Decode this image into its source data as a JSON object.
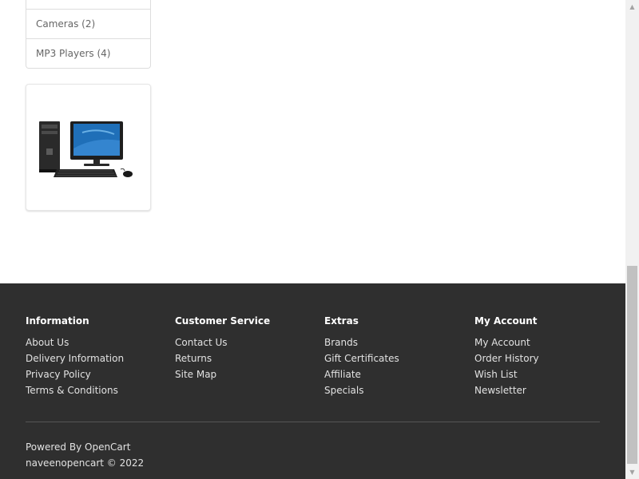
{
  "categories": {
    "items": [
      {
        "label": ""
      },
      {
        "label": "Cameras (2)"
      },
      {
        "label": "MP3 Players (4)"
      }
    ]
  },
  "banner": {
    "icon": "desktop-computer-image"
  },
  "footer": {
    "columns": [
      {
        "title": "Information",
        "links": [
          "About Us",
          "Delivery Information",
          "Privacy Policy",
          "Terms & Conditions"
        ]
      },
      {
        "title": "Customer Service",
        "links": [
          "Contact Us",
          "Returns",
          "Site Map"
        ]
      },
      {
        "title": "Extras",
        "links": [
          "Brands",
          "Gift Certificates",
          "Affiliate",
          "Specials"
        ]
      },
      {
        "title": "My Account",
        "links": [
          "My Account",
          "Order History",
          "Wish List",
          "Newsletter"
        ]
      }
    ],
    "powered_prefix": "Powered By",
    "powered_link": "OpenCart",
    "copyright": "naveenopencart © 2022"
  },
  "colors": {
    "footer_bg": "#2f2f2f",
    "footer_text": "#e2e2e2",
    "heading": "#ffffff",
    "category_text": "#666666",
    "border": "#dddddd"
  },
  "scrollbar": {
    "up_icon": "scroll-up-arrow-icon",
    "down_icon": "scroll-down-arrow-icon"
  }
}
